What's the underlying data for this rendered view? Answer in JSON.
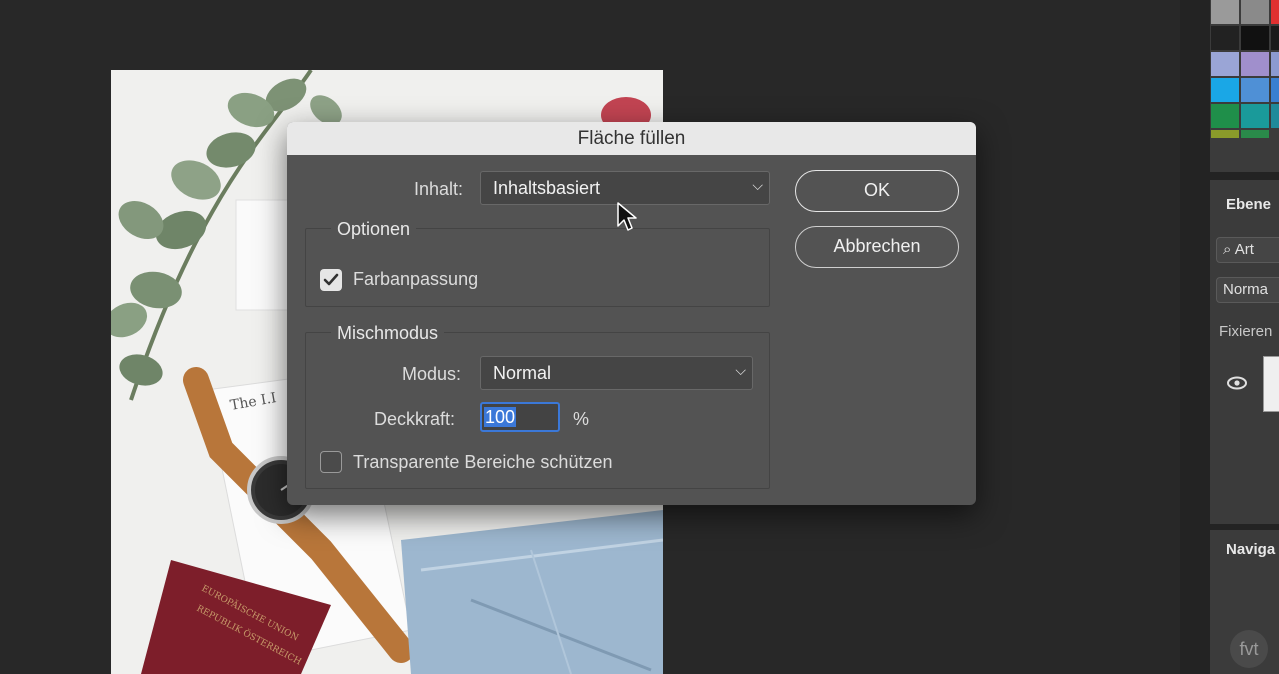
{
  "dialog": {
    "title": "Fläche füllen",
    "content_label": "Inhalt:",
    "content_value": "Inhaltsbasiert",
    "ok_label": "OK",
    "cancel_label": "Abbrechen",
    "options": {
      "title": "Optionen",
      "color_adaptation_label": "Farbanpassung",
      "color_adaptation_checked": true
    },
    "blend": {
      "title": "Mischmodus",
      "mode_label": "Modus:",
      "mode_value": "Normal",
      "opacity_label": "Deckkraft:",
      "opacity_value": "100",
      "opacity_unit": "%",
      "preserve_transparency_label": "Transparente Bereiche schützen",
      "preserve_transparency_checked": false
    }
  },
  "layers_panel": {
    "title": "Ebene",
    "search_value": "Art",
    "blend_value": "Norma",
    "lock_label": "Fixieren"
  },
  "navigator_panel": {
    "title": "Naviga"
  },
  "watermark": "fvt",
  "colors": {
    "dialog_bg": "#535353",
    "accent": "#3b78d8",
    "workspace": "#282828"
  },
  "icons": [
    "check-icon",
    "chevron-down-icon",
    "eye-icon",
    "search-icon",
    "mouse-pointer-icon"
  ]
}
